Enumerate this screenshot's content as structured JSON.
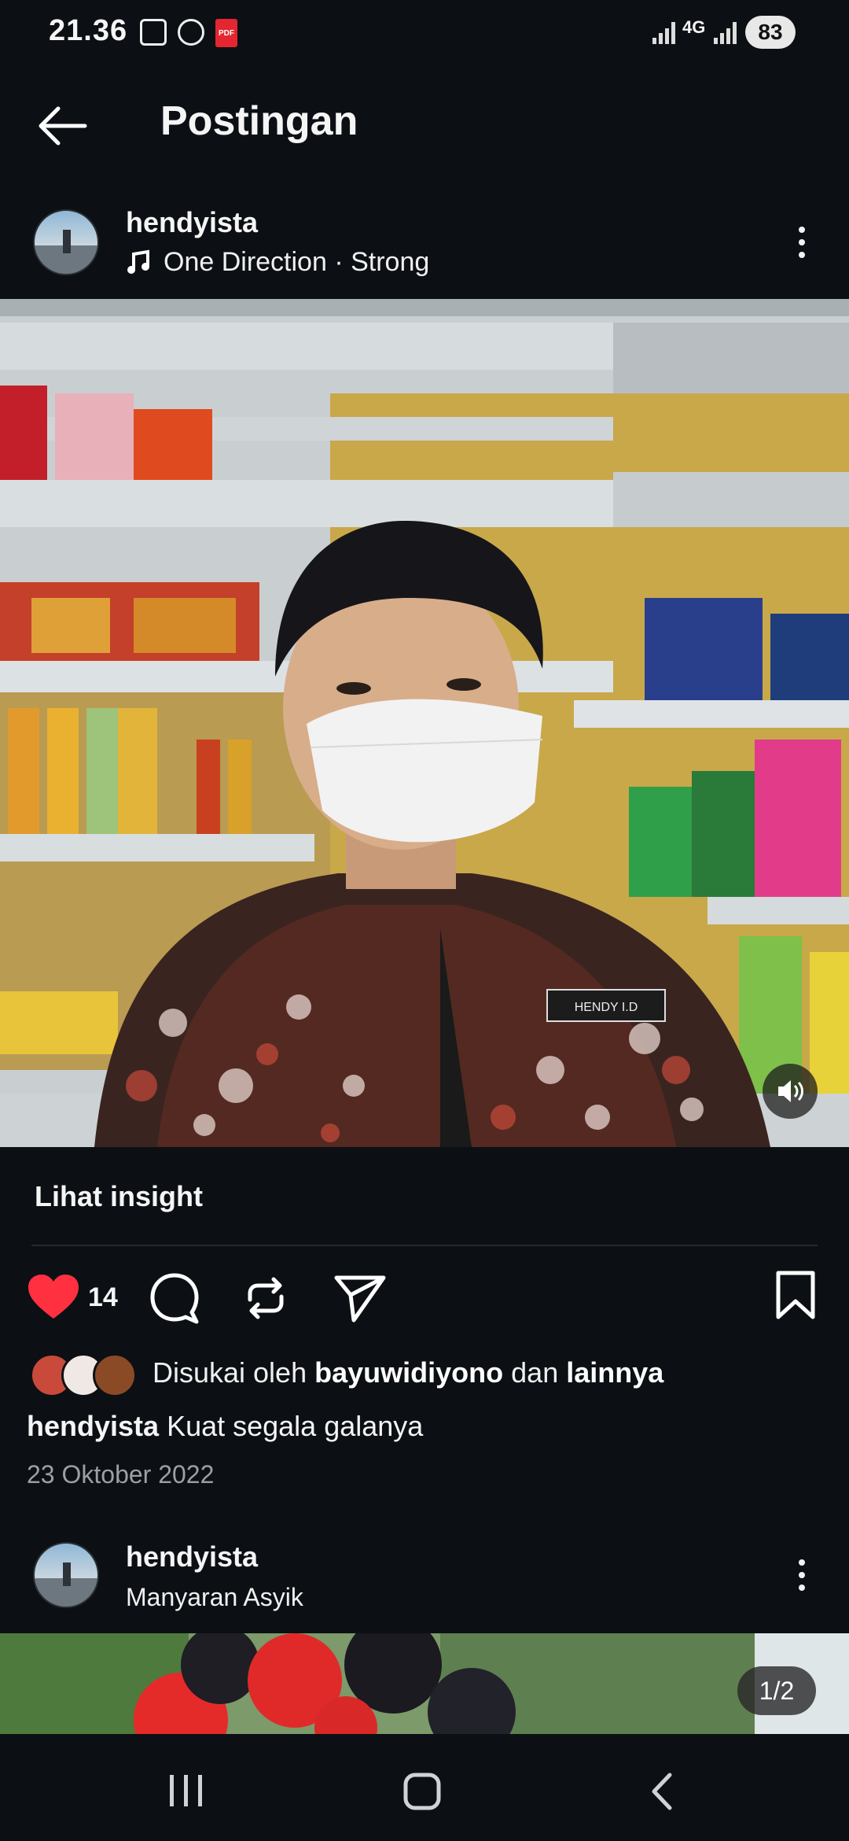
{
  "status_bar": {
    "time": "21.36",
    "pdf_label": "PDF",
    "network": "4G",
    "battery": "83"
  },
  "header": {
    "title": "Postingan"
  },
  "post1": {
    "username": "hendyista",
    "music": "One Direction · Strong",
    "media_alt": "Selfie of person in batik shirt and white mask in a store",
    "name_tag": "HENDY I.D",
    "insights_label": "Lihat insight",
    "likes_count": "14",
    "liked_by_prefix": "Disukai oleh",
    "liked_by_user": "bayuwidiyono",
    "liked_by_conj": "dan",
    "liked_by_others": "lainnya",
    "caption_user": "hendyista",
    "caption_text": "Kuat segala galanya",
    "date": "23 Oktober 2022"
  },
  "post2": {
    "username": "hendyista",
    "location": "Manyaran Asyik",
    "carousel_counter": "1/2"
  },
  "colors": {
    "like": "#ff3040",
    "background": "#0c1015"
  }
}
